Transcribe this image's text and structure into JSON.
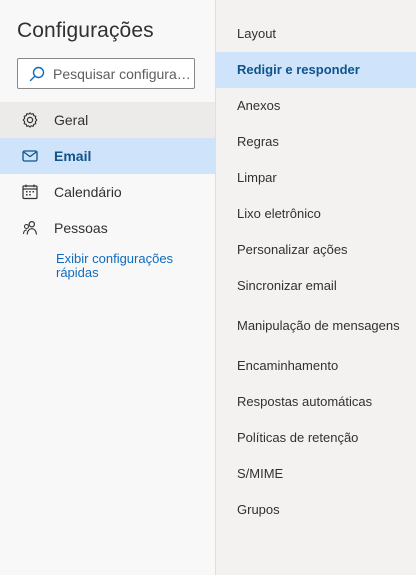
{
  "app": {
    "title": "Configurações"
  },
  "search": {
    "placeholder": "Pesquisar configurações"
  },
  "nav": {
    "items": [
      {
        "label": "Geral",
        "icon": "gear-icon"
      },
      {
        "label": "Email",
        "icon": "mail-icon",
        "selected": true
      },
      {
        "label": "Calendário",
        "icon": "calendar-icon"
      },
      {
        "label": "Pessoas",
        "icon": "people-icon"
      }
    ],
    "quick_link": "Exibir configurações rápidas"
  },
  "submenu": {
    "items": [
      {
        "label": "Layout"
      },
      {
        "label": "Redigir e responder",
        "selected": true
      },
      {
        "label": "Anexos"
      },
      {
        "label": "Regras"
      },
      {
        "label": "Limpar"
      },
      {
        "label": "Lixo eletrônico"
      },
      {
        "label": "Personalizar ações"
      },
      {
        "label": "Sincronizar email"
      },
      {
        "label": "Manipulação de mensagens"
      },
      {
        "label": "Encaminhamento"
      },
      {
        "label": "Respostas automáticas"
      },
      {
        "label": "Políticas de retenção"
      },
      {
        "label": "S/MIME"
      },
      {
        "label": "Grupos"
      }
    ]
  },
  "colors": {
    "accent": "#0f6cbd",
    "selected_background": "#cfe4fa",
    "selected_text": "#0f548c",
    "pane_background": "#f3f2f1"
  }
}
